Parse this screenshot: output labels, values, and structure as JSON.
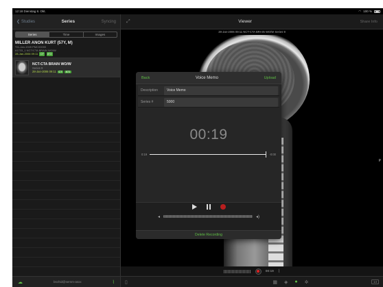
{
  "status_bar": {
    "time_date": "12:18  Dienstag 8. Okt.",
    "battery": "100 %"
  },
  "sidebar": {
    "back_label": "Studies",
    "title": "Series",
    "sync_label": "Syncing",
    "segments": [
      "Series",
      "Time",
      "Images"
    ],
    "patient": {
      "name": "MILLER ANON KURT (57Y, M)",
      "line1": "*01-Jan-1949  PMC00000",
      "line2": "#1733_1  NCT/CTA BRAIN WO/W",
      "date": "28-Jan-2006 09:11",
      "badges": [
        "CT",
        "872"
      ]
    },
    "series": {
      "title": "NCT-CTA BRAIN WO/W",
      "number": "Series 9",
      "date": "28-Jan-2006 09:11",
      "badges": [
        "CT",
        "872"
      ]
    },
    "email": "bschid@semm-asxx"
  },
  "viewer": {
    "title": "Viewer",
    "action": "Share Info",
    "image_label": "28-Jan-2006 09:11  NCT-CTA BRAIN WO/W  Series 9",
    "orientation_marker": "P",
    "record_time": "00:19",
    "page_badge": "14"
  },
  "voice_memo": {
    "back_label": "Back",
    "title": "Voice Memo",
    "upload_label": "Upload",
    "description_label": "Description",
    "description_value": "Voice Memo",
    "series_label": "Series #",
    "series_value": "5000",
    "timer": "00:19",
    "elapsed": "0:19",
    "remaining": "-0:00",
    "delete_label": "Delete Recording"
  }
}
